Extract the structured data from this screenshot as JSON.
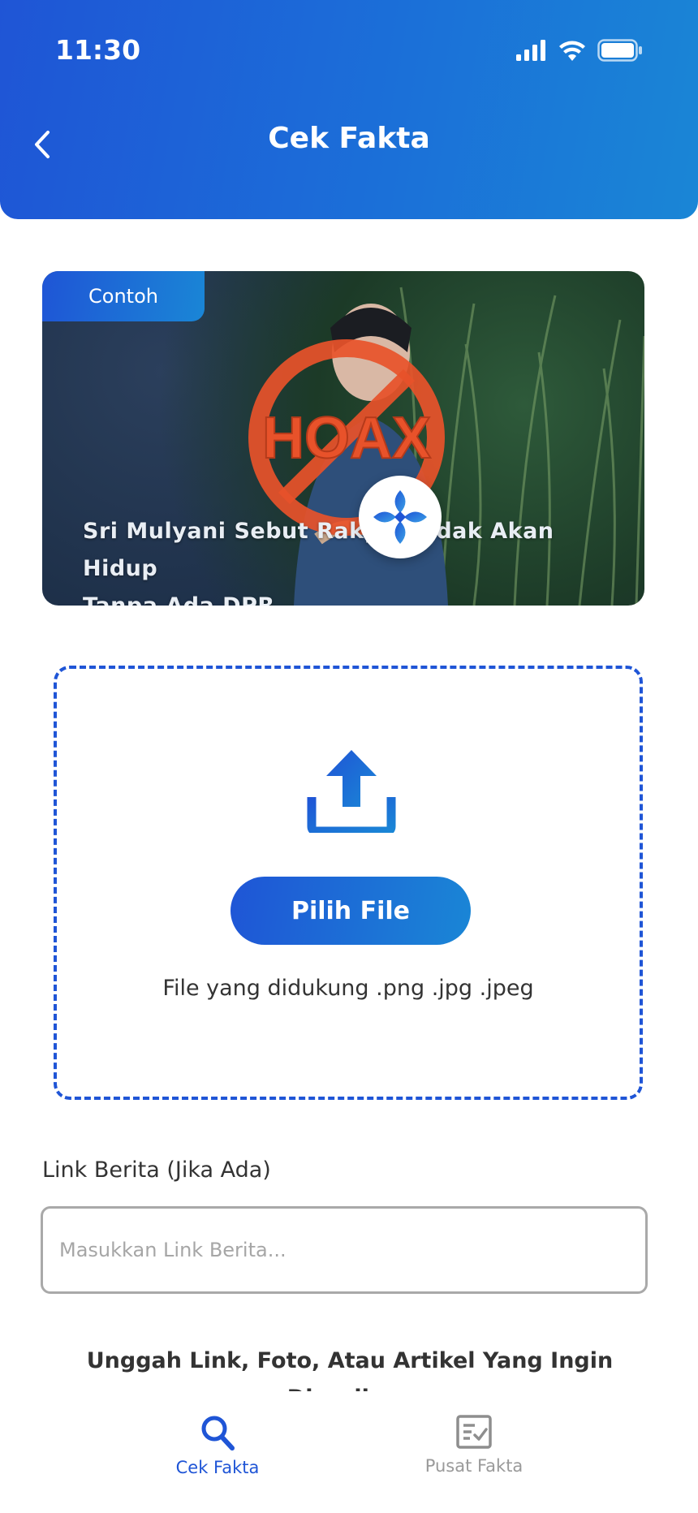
{
  "status_bar": {
    "time": "11:30"
  },
  "header": {
    "title": "Cek Fakta"
  },
  "example_card": {
    "badge": "Contoh",
    "caption_line1": "Sri Mulyani Sebut Rakyat Tidak Akan Hidup",
    "caption_line2": "Tanpa Ada DPR",
    "stamp_text": "HOAX"
  },
  "upload": {
    "button_label": "Pilih File",
    "supported_text": "File yang didukung .png .jpg .jpeg"
  },
  "link_field": {
    "label": "Link Berita (Jika Ada)",
    "placeholder": "Masukkan Link Berita..."
  },
  "instruction_text": "Unggah Link, Foto, Atau Artikel Yang Ingin Diperiksa,",
  "bottom_nav": {
    "items": [
      {
        "label": "Cek Fakta",
        "icon": "search-icon",
        "active": true
      },
      {
        "label": "Pusat Fakta",
        "icon": "checklist-icon",
        "active": false
      }
    ]
  },
  "colors": {
    "primary": "#1f55d6",
    "accent": "#1a86d6",
    "stamp": "#e8522a"
  }
}
